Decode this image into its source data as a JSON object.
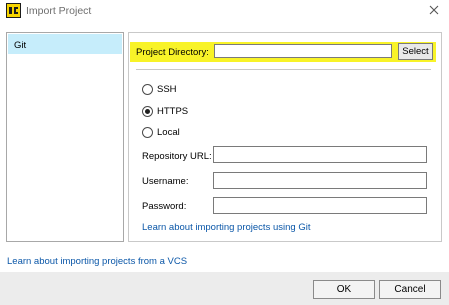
{
  "window": {
    "title": "Import Project"
  },
  "sidebar": {
    "items": [
      {
        "label": "Git"
      }
    ]
  },
  "project_directory": {
    "label": "Project Directory:",
    "value": "",
    "select_button": "Select"
  },
  "protocol": {
    "options": [
      {
        "label": "SSH",
        "checked": false
      },
      {
        "label": "HTTPS",
        "checked": true
      },
      {
        "label": "Local",
        "checked": false
      }
    ]
  },
  "fields": {
    "repository_url": {
      "label": "Repository URL:",
      "value": ""
    },
    "username": {
      "label": "Username:",
      "value": ""
    },
    "password": {
      "label": "Password:",
      "value": ""
    }
  },
  "links": {
    "git_help": "Learn about importing projects using Git",
    "vcs_help": "Learn about importing projects from a VCS"
  },
  "buttons": {
    "ok": "OK",
    "cancel": "Cancel"
  },
  "colors": {
    "highlight": "#f8f328",
    "sidebar_selected": "#c6edfb",
    "link": "#0b57a8"
  },
  "icons": {
    "app": "app-logo-icon",
    "close": "close-icon"
  }
}
